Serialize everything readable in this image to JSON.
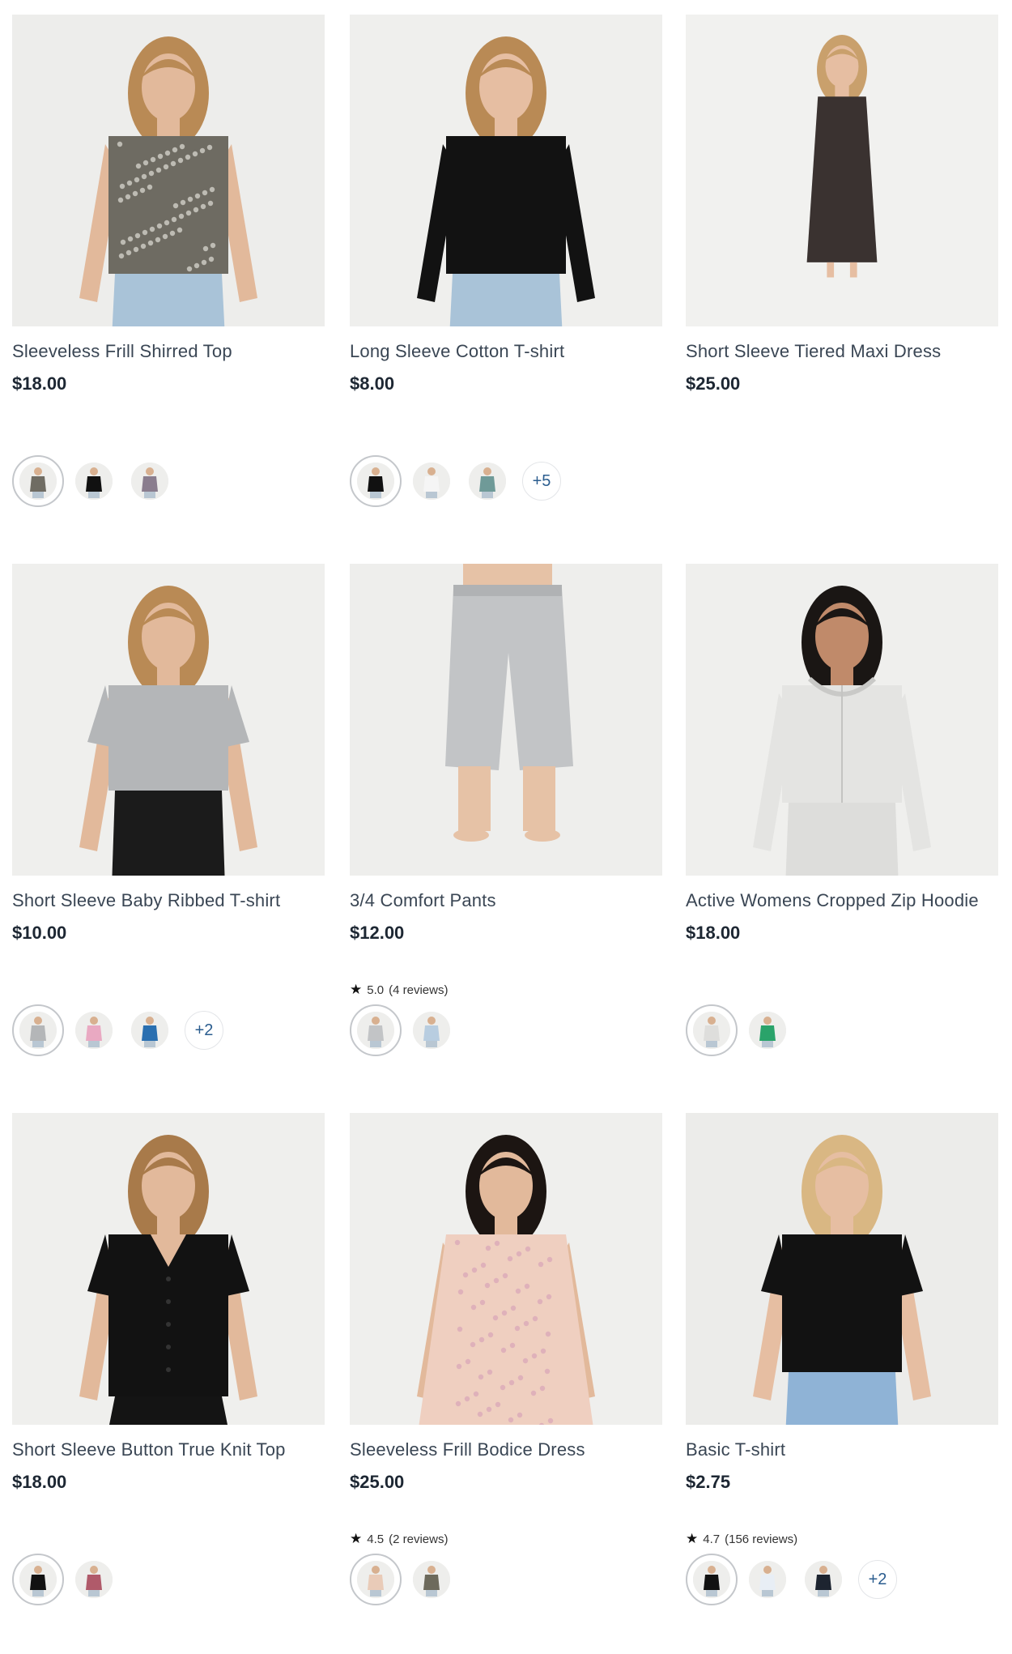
{
  "products": [
    {
      "name": "Sleeveless Frill Shirred Top",
      "price": "$18.00",
      "rating": null,
      "image": {
        "bg": "#ededeb",
        "skin": "#e2b99b",
        "hair": "#b98a55",
        "garment": "garment-sleeveless-top",
        "garment_color": "#6e6b62",
        "pattern": true,
        "bottoms": "jeans",
        "bottom_color": "#a9c3d8"
      },
      "swatches": [
        "#6f6c63",
        "#111111",
        "#8a7d8e"
      ],
      "more": null
    },
    {
      "name": "Long Sleeve Cotton T-shirt",
      "price": "$8.00",
      "rating": null,
      "image": {
        "bg": "#efefed",
        "skin": "#e6bea2",
        "hair": "#b98a55",
        "garment": "garment-long-sleeve",
        "garment_color": "#121212",
        "pattern": false,
        "bottoms": "jeans",
        "bottom_color": "#a9c3d8"
      },
      "swatches": [
        "#111111",
        "#f5f5f5",
        "#6f9a98"
      ],
      "more": "+5"
    },
    {
      "name": "Short Sleeve Tiered Maxi Dress",
      "price": "$25.00",
      "rating": null,
      "image": {
        "bg": "#f1f1ef",
        "skin": "#e6bea2",
        "hair": "#c9a06c",
        "garment": "garment-maxi-dress",
        "garment_color": "#3a3230",
        "pattern": true,
        "bottoms": "none",
        "bottom_color": "#000000"
      },
      "swatches": [],
      "more": null
    },
    {
      "name": "Short Sleeve Baby Ribbed T-shirt",
      "price": "$10.00",
      "rating": null,
      "image": {
        "bg": "#efefed",
        "skin": "#e2b99b",
        "hair": "#b98a55",
        "garment": "garment-crop-tee",
        "garment_color": "#b4b6b8",
        "pattern": false,
        "bottoms": "jeans",
        "bottom_color": "#1b1b1b"
      },
      "swatches": [
        "#b4b6b8",
        "#e9a9c2",
        "#2a6fb0"
      ],
      "more": "+2"
    },
    {
      "name": "3/4 Comfort Pants",
      "price": "$12.00",
      "rating": {
        "score": "5.0",
        "reviews": "(4 reviews)"
      },
      "image": {
        "bg": "#eeeeec",
        "skin": "#e6c2a6",
        "hair": "#000000",
        "garment": "garment-pants",
        "garment_color": "#c2c4c6",
        "pattern": false,
        "bottoms": "none",
        "bottom_color": "#000000"
      },
      "swatches": [
        "#c2c4c6",
        "#b8cde0"
      ],
      "more": null
    },
    {
      "name": "Active Womens Cropped Zip Hoodie",
      "price": "$18.00",
      "rating": null,
      "image": {
        "bg": "#efefed",
        "skin": "#c08a6a",
        "hair": "#1a1614",
        "garment": "garment-hoodie",
        "garment_color": "#e4e4e2",
        "pattern": false,
        "bottoms": "joggers",
        "bottom_color": "#dddddb"
      },
      "swatches": [
        "#dededc",
        "#2aa36a"
      ],
      "more": null
    },
    {
      "name": "Short Sleeve Button True Knit Top",
      "price": "$18.00",
      "rating": null,
      "image": {
        "bg": "#efefed",
        "skin": "#e2b99b",
        "hair": "#a87a4a",
        "garment": "garment-button-top",
        "garment_color": "#121212",
        "pattern": false,
        "bottoms": "skirt",
        "bottom_color": "#141414"
      },
      "swatches": [
        "#121212",
        "#b05a6a"
      ],
      "more": null
    },
    {
      "name": "Sleeveless Frill Bodice Dress",
      "price": "$25.00",
      "rating": {
        "score": "4.5",
        "reviews": "(2 reviews)"
      },
      "image": {
        "bg": "#efefed",
        "skin": "#e2b99b",
        "hair": "#1c1512",
        "garment": "garment-frill-dress",
        "garment_color": "#efcfc0",
        "pattern": true,
        "bottoms": "none",
        "bottom_color": "#000000"
      },
      "swatches": [
        "#e9cbb8",
        "#6d6a5c"
      ],
      "more": null
    },
    {
      "name": "Basic T-shirt",
      "price": "$2.75",
      "rating": {
        "score": "4.7",
        "reviews": "(156 reviews)"
      },
      "image": {
        "bg": "#ececea",
        "skin": "#e6bea2",
        "hair": "#d9b783",
        "garment": "garment-basic-tee",
        "garment_color": "#121212",
        "pattern": false,
        "bottoms": "jeans",
        "bottom_color": "#8fb3d6"
      },
      "swatches": [
        "#121212",
        "#e8eef5",
        "#1d2430"
      ],
      "more": "+2"
    }
  ]
}
